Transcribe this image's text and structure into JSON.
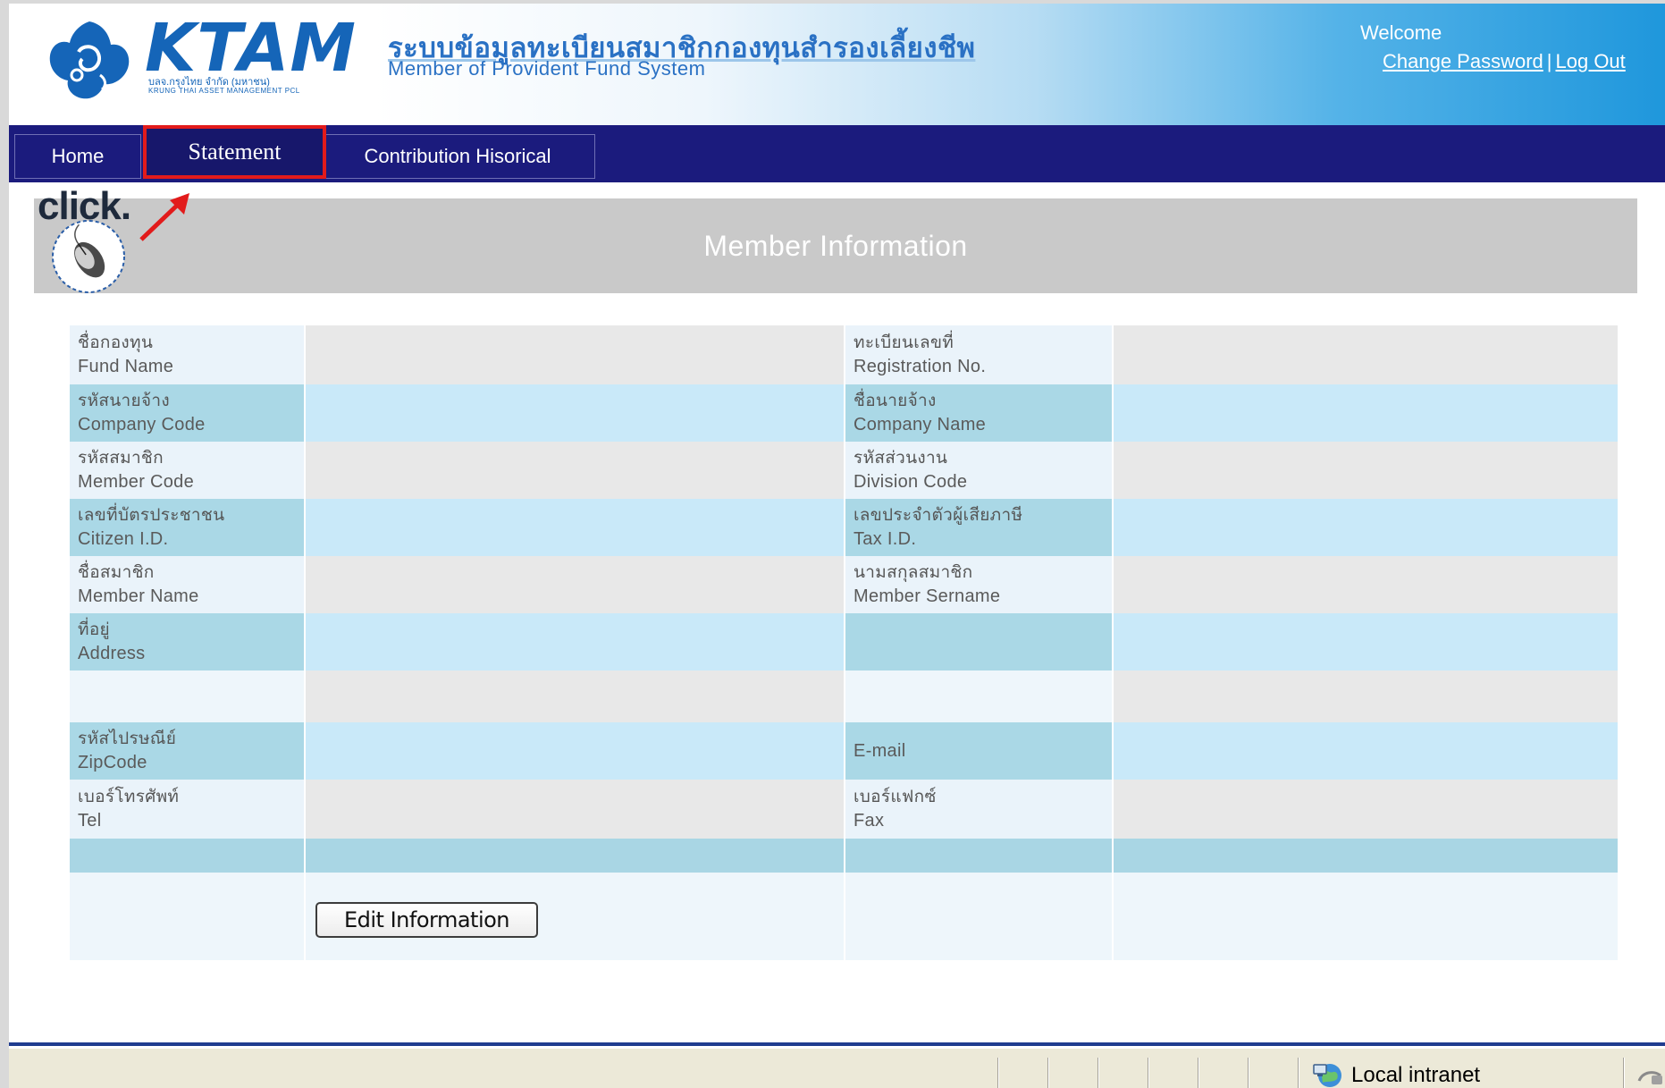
{
  "header": {
    "logo_text": "KTAM",
    "logo_sub_th": "บลจ.กรุงไทย จำกัด (มหาชน)",
    "logo_sub_en": "KRUNG THAI ASSET MANAGEMENT PCL",
    "system_title_th": "ระบบข้อมูลทะเบียนสมาชิกกองทุนสำรองเลี้ยงชีพ",
    "system_title_en": "Member of Provident Fund System",
    "welcome": "Welcome",
    "change_password": "Change Password",
    "separator": "|",
    "logout": "Log Out"
  },
  "nav": {
    "home": "Home",
    "statement": "Statement",
    "contribution": "Contribution Hisorical"
  },
  "annotation": {
    "click": "click."
  },
  "section_title": "Member Information",
  "form": {
    "rows": [
      {
        "left_th": "ชื่อกองทุน",
        "left_en": "Fund Name",
        "right_th": "ทะเบียนเลขที่",
        "right_en": "Registration No."
      },
      {
        "left_th": "รหัสนายจ้าง",
        "left_en": "Company  Code",
        "right_th": "ชื่อนายจ้าง",
        "right_en": "Company  Name"
      },
      {
        "left_th": "รหัสสมาชิก",
        "left_en": "Member Code",
        "right_th": "รหัสส่วนงาน",
        "right_en": "Division Code"
      },
      {
        "left_th": "เลขที่บัตรประชาชน",
        "left_en": "Citizen I.D.",
        "right_th": "เลขประจำตัวผู้เสียภาษี",
        "right_en": "Tax I.D."
      },
      {
        "left_th": "ชื่อสมาชิก",
        "left_en": "Member Name",
        "right_th": "นามสกุลสมาชิก",
        "right_en": "Member Sername"
      },
      {
        "left_th": "ที่อยู่",
        "left_en": "Address",
        "right_th": "",
        "right_en": ""
      },
      {
        "left_th": "",
        "left_en": "",
        "right_th": "",
        "right_en": ""
      },
      {
        "left_th": "รหัสไปรษณีย์",
        "left_en": "ZipCode",
        "right_th": "",
        "right_en": "E-mail"
      },
      {
        "left_th": "เบอร์โทรศัพท์",
        "left_en": "Tel",
        "right_th": "เบอร์แฟกซ์",
        "right_en": "Fax"
      }
    ],
    "edit_button": "Edit Information"
  },
  "statusbar": {
    "zone": "Local intranet"
  },
  "colors": {
    "nav_bg": "#1b1b7d",
    "highlight": "#e21b1b",
    "section_bg": "#c9c9c9",
    "label_blue": "#aad8e6",
    "value_blue": "#c9e9f9"
  }
}
